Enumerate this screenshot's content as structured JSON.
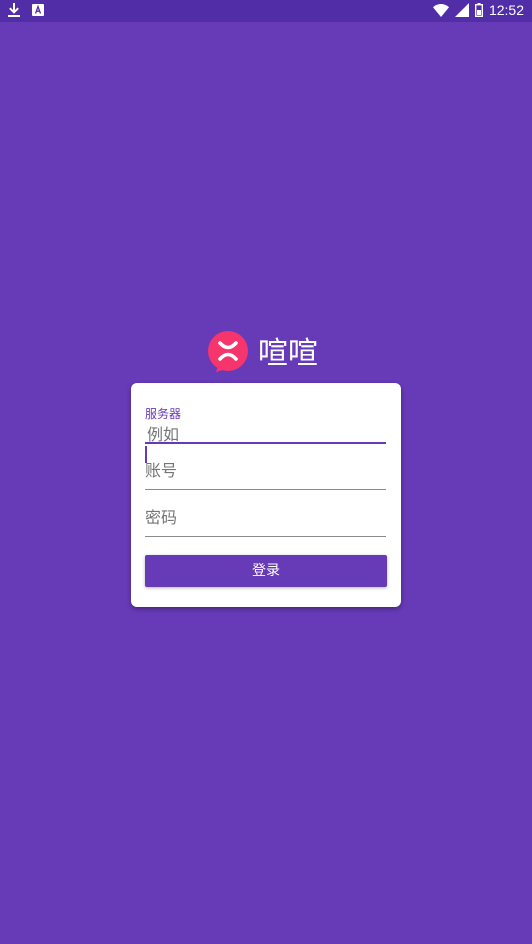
{
  "status_bar": {
    "time": "12:52",
    "icons": [
      "download-icon",
      "text-a-icon",
      "wifi-icon",
      "signal-icon",
      "battery-icon"
    ]
  },
  "brand": {
    "name": "喧喧",
    "logo_color": "#f5356c"
  },
  "login_form": {
    "server": {
      "label": "服务器",
      "placeholder": "例如"
    },
    "account": {
      "placeholder": "账号"
    },
    "password": {
      "placeholder": "密码"
    },
    "login_button": "登录"
  },
  "colors": {
    "primary": "#673ab7",
    "status_bar": "#512da8",
    "card": "#ffffff"
  }
}
